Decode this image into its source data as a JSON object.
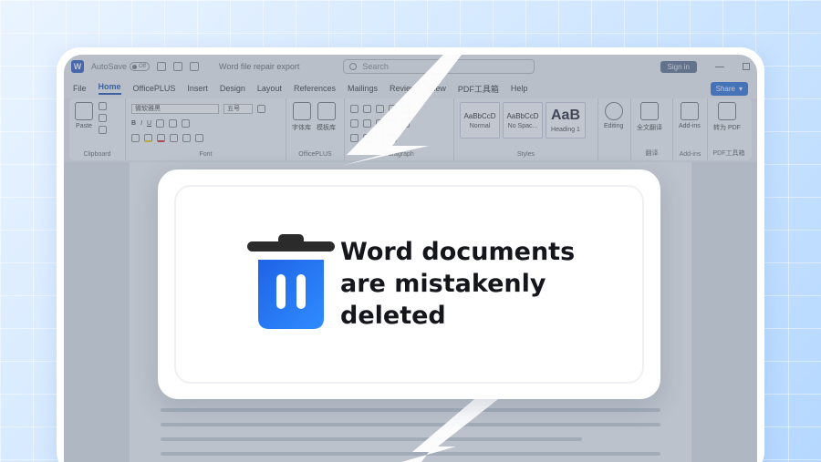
{
  "titlebar": {
    "autosave_label": "AutoSave",
    "autosave_state": "Off",
    "doc_title": "Word file repair export",
    "search_placeholder": "Search",
    "signin_label": "Sign in"
  },
  "menu": {
    "tabs": [
      "File",
      "Home",
      "OfficePLUS",
      "Insert",
      "Design",
      "Layout",
      "References",
      "Mailings",
      "Review",
      "View",
      "PDF工具箱",
      "Help"
    ],
    "active_tab": "Home",
    "share_label": "Share"
  },
  "ribbon": {
    "paste_label": "Paste",
    "font_name": "微软雅黑",
    "font_size": "五号",
    "clipboard_label": "Clipboard",
    "font_label": "Font",
    "officeplus_tools": [
      "字体库",
      "模板库"
    ],
    "officeplus_label": "OfficePLUS",
    "paragraph_label": "Paragraph",
    "styles": [
      {
        "preview": "AaBbCcD",
        "name": "Normal"
      },
      {
        "preview": "AaBbCcD",
        "name": "No Spac..."
      },
      {
        "preview": "AaB",
        "name": "Heading 1"
      }
    ],
    "styles_label": "Styles",
    "editing_label": "Editing",
    "translate_tool": "全文翻译",
    "translate_label": "翻译",
    "addins_tool": "Add-ins",
    "addins_label": "Add-ins",
    "pdf_tool": "转为 PDF",
    "pdf_label": "PDF工具箱"
  },
  "card": {
    "message": "Word documents\nare mistakenly\ndeleted",
    "icon": "trash-icon",
    "accent_color": "#1a73f0"
  }
}
